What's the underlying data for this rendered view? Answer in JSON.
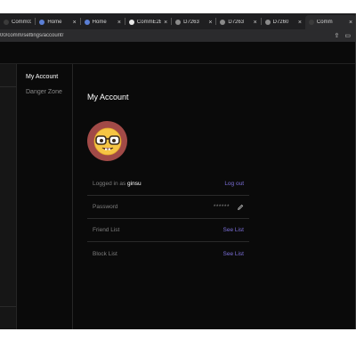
{
  "browser": {
    "tabs": [
      {
        "label": "Comm02(",
        "favicon": "comm-favicon",
        "active": false,
        "show_close": false
      },
      {
        "label": "Home",
        "favicon": "home-favicon",
        "active": false,
        "show_close": true
      },
      {
        "label": "Home",
        "favicon": "home-favicon",
        "active": false,
        "show_close": true
      },
      {
        "label": "CommE2E",
        "favicon": "github-favicon",
        "active": false,
        "show_close": true
      },
      {
        "label": "D7263",
        "favicon": "phabricator-favicon",
        "active": false,
        "show_close": true
      },
      {
        "label": "D7263",
        "favicon": "phabricator-favicon",
        "active": false,
        "show_close": true
      },
      {
        "label": "D7260",
        "favicon": "phabricator-favicon",
        "active": false,
        "show_close": true
      },
      {
        "label": "Comm",
        "favicon": "comm-favicon",
        "active": true,
        "show_close": true
      }
    ],
    "tab_close_glyph": "×",
    "url": "00/comm/settings/account/"
  },
  "settings_nav": {
    "items": [
      {
        "label": "My Account",
        "active": true
      },
      {
        "label": "Danger Zone",
        "active": false
      }
    ]
  },
  "account": {
    "title": "My Account",
    "avatar_emoji": "🤓",
    "logged_in_prefix": "Logged in as",
    "username": "ginsu",
    "logout_label": "Log out",
    "password_label": "Password",
    "password_mask": "******",
    "friend_list_label": "Friend List",
    "friend_list_link": "See List",
    "block_list_label": "Block List",
    "block_list_link": "See List"
  },
  "colors": {
    "background": "#0a0a0a",
    "link": "#7b6fd8",
    "avatar_bg": "#a14a47",
    "text_muted": "#7e7e7e",
    "text_primary": "#ffffff"
  }
}
